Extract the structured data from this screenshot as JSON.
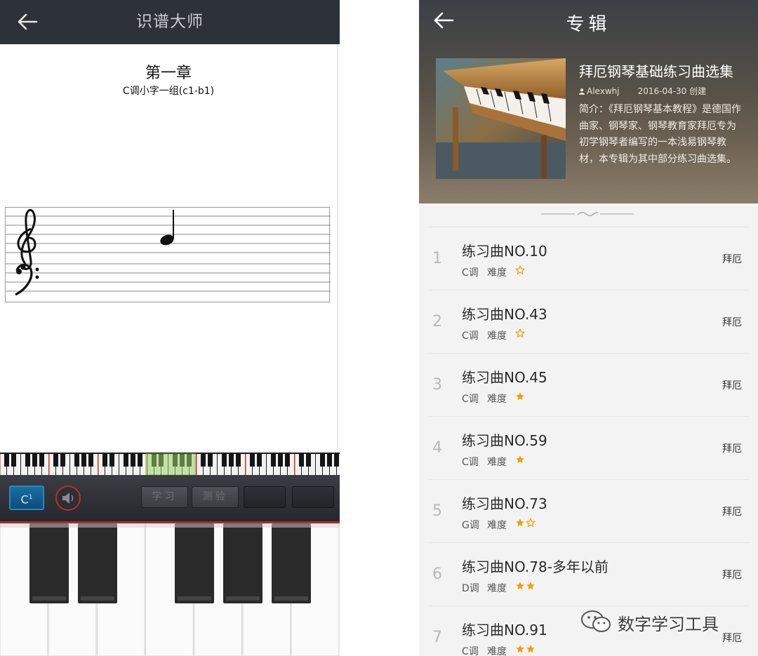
{
  "left_screen": {
    "title": "识谱大师",
    "chapter": "第一章",
    "subtitle": "C调小字一组(c1-b1)",
    "key_button": "C",
    "key_button_sup": "1",
    "buttons": {
      "learn": "学习",
      "test": "测验"
    }
  },
  "right_screen": {
    "title": "专辑",
    "album": {
      "name": "拜厄钢琴基础练习曲选集",
      "author": "Alexwhj",
      "created": "2016-04-30 创建",
      "intro": "简介：《拜厄钢琴基本教程》是德国作曲家、钢琴家、钢琴教育家拜厄专为初学钢琴者编写的一本浅易钢琴教材，本专辑为其中部分练习曲选集。"
    },
    "difficulty_label": "难度",
    "colors": {
      "star": "#f0a000"
    },
    "songs": [
      {
        "num": "1",
        "title": "练习曲NO.10",
        "key": "C调",
        "stars": 0.5,
        "artist": "拜厄"
      },
      {
        "num": "2",
        "title": "练习曲NO.43",
        "key": "C调",
        "stars": 0.5,
        "artist": "拜厄"
      },
      {
        "num": "3",
        "title": "练习曲NO.45",
        "key": "C调",
        "stars": 1,
        "artist": "拜厄"
      },
      {
        "num": "4",
        "title": "练习曲NO.59",
        "key": "C调",
        "stars": 1,
        "artist": "拜厄"
      },
      {
        "num": "5",
        "title": "练习曲NO.73",
        "key": "G调",
        "stars": 1.5,
        "artist": "拜厄"
      },
      {
        "num": "6",
        "title": "练习曲NO.78-多年以前",
        "key": "D调",
        "stars": 2,
        "artist": "拜厄"
      },
      {
        "num": "7",
        "title": "练习曲NO.91",
        "key": "C调",
        "stars": 2,
        "artist": "拜厄"
      }
    ]
  },
  "watermark": "数字学习工具"
}
